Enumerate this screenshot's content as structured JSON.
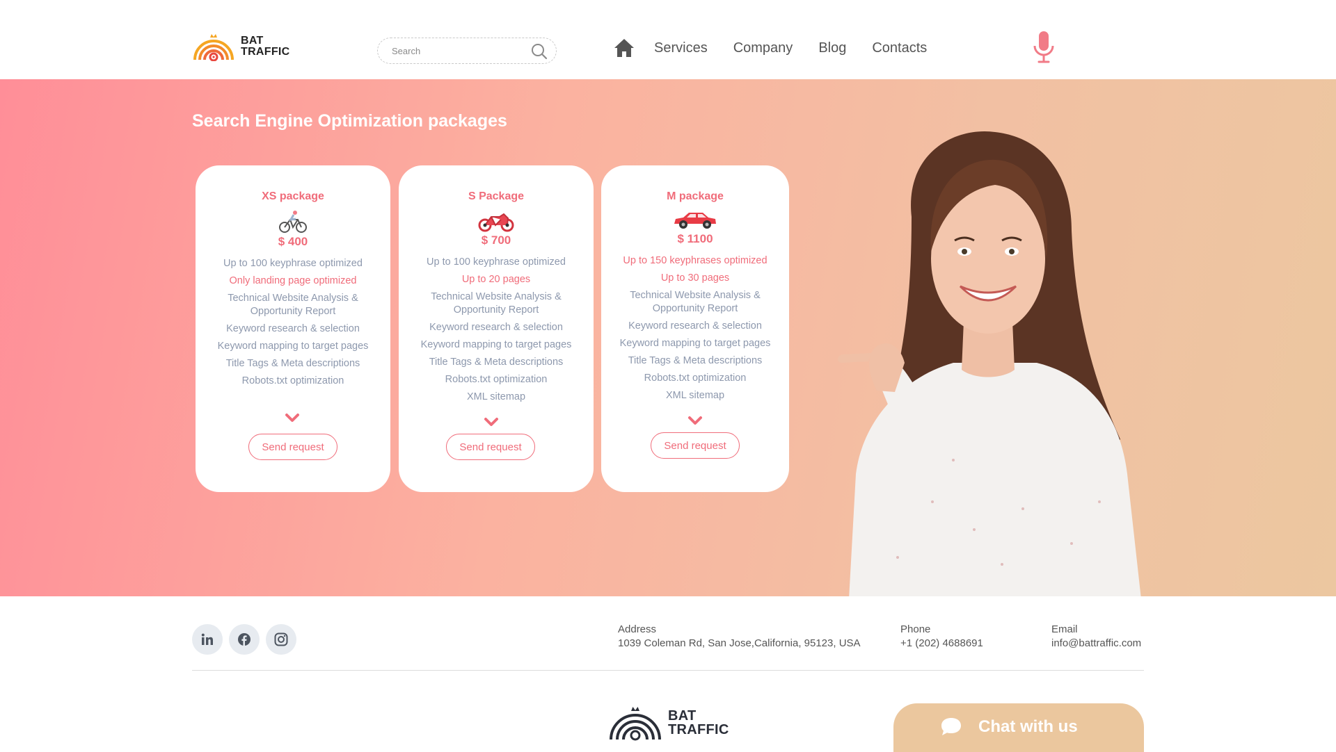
{
  "header": {
    "logo_line1": "BAT",
    "logo_line2": "TRAFFIC",
    "search_placeholder": "Search",
    "nav": [
      "Services",
      "Company",
      "Blog",
      "Contacts"
    ]
  },
  "hero": {
    "title": "Search Engine Optimization packages"
  },
  "packages": [
    {
      "name": "XS package",
      "icon": "bicycle-icon",
      "price": "$ 400",
      "features": [
        "Up to 100 keyphrase optimized",
        "Only landing page optimized",
        "Technical Website Analysis & Opportunity Report",
        "Keyword research & selection",
        "Keyword mapping to target pages",
        "Title Tags & Meta descriptions",
        "Robots.txt optimization"
      ],
      "button": "Send request"
    },
    {
      "name": "S Package",
      "icon": "motorcycle-icon",
      "price": "$ 700",
      "features": [
        "Up to 100 keyphrase optimized",
        "Up to 20 pages",
        "Technical Website Analysis & Opportunity Report",
        "Keyword research & selection",
        "Keyword mapping to target pages",
        "Title Tags & Meta descriptions",
        "Robots.txt optimization",
        "XML sitemap"
      ],
      "button": "Send request"
    },
    {
      "name": "M package",
      "icon": "car-icon",
      "price": "$ 1100",
      "features": [
        "Up to 150 keyphrases optimized",
        "Up to 30 pages",
        "Technical Website Analysis & Opportunity Report",
        "Keyword research & selection",
        "Keyword mapping to target pages",
        "Title Tags & Meta descriptions",
        "Robots.txt optimization",
        "XML sitemap"
      ],
      "button": "Send request"
    }
  ],
  "footer": {
    "socials": [
      "linkedin-icon",
      "facebook-icon",
      "instagram-icon"
    ],
    "address_label": "Address",
    "address": "1039 Coleman Rd, San Jose,California,  95123, USA",
    "phone_label": "Phone",
    "phone": "+1 (202) 4688691",
    "email_label": "Email",
    "email": "info@battraffic.com",
    "logo_line1": "BAT",
    "logo_line2": "TRAFFIC",
    "chat_label": "Chat with us"
  },
  "colors": {
    "accent": "#f06c7a",
    "muted_text": "#8d98ad",
    "chat_bg": "#ebc79e",
    "hero_gradient_start": "#ff8e98",
    "hero_gradient_end": "#ecc7a0"
  }
}
